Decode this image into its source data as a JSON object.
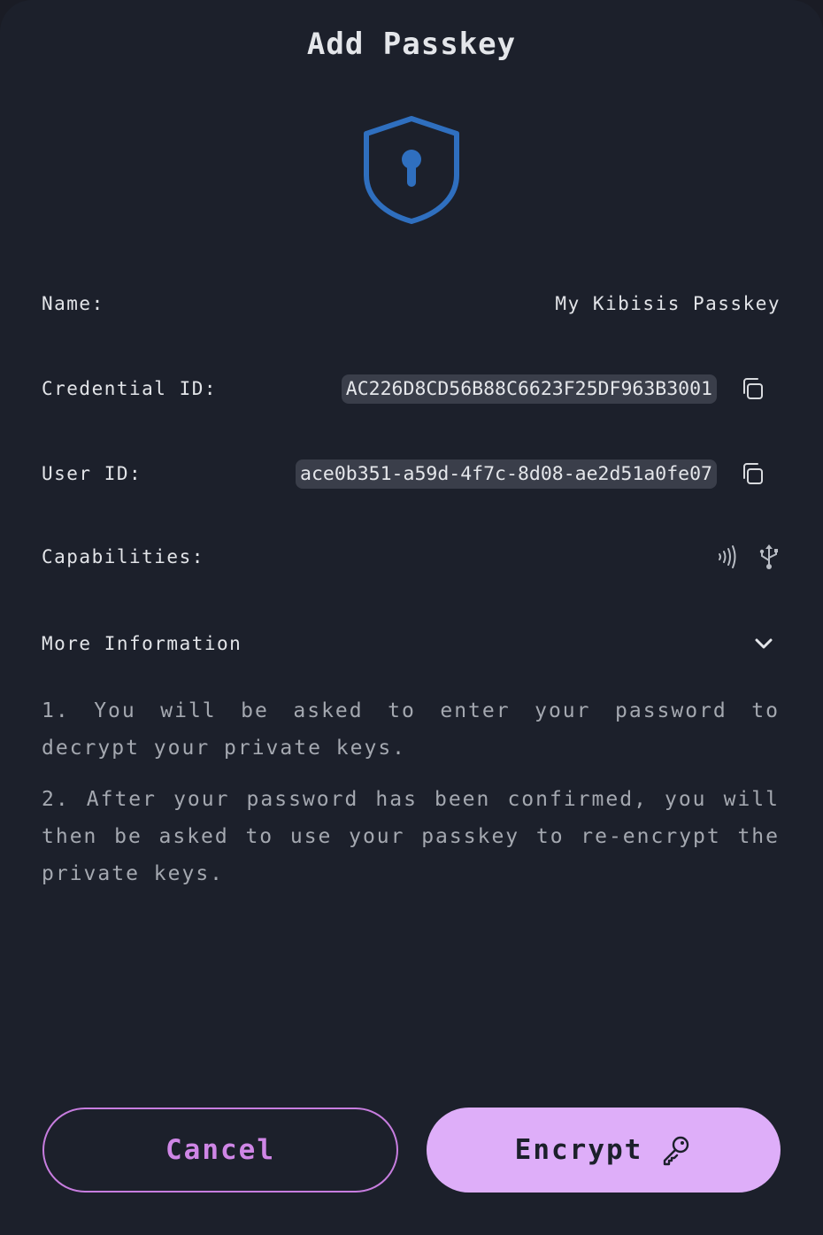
{
  "dialog": {
    "title": "Add Passkey"
  },
  "fields": {
    "name_label": "Name:",
    "name_value": "My Kibisis Passkey",
    "credential_label": "Credential ID:",
    "credential_value": "AC226D8CD56B88C6623F25DF963B3001",
    "user_label": "User ID:",
    "user_value": "ace0b351-a59d-4f7c-8d08-ae2d51a0fe07",
    "capabilities_label": "Capabilities:",
    "capabilities": [
      "nfc-icon",
      "usb-icon"
    ]
  },
  "more_info": {
    "label": "More Information",
    "step1": "1. You will be asked to enter your password to decrypt your private keys.",
    "step2": "2. After your password has been confirmed, you will then be asked to use your passkey to re-encrypt the private keys."
  },
  "actions": {
    "cancel_label": "Cancel",
    "encrypt_label": "Encrypt"
  },
  "colors": {
    "background": "#1c202b",
    "shield": "#2f6fbf",
    "accent": "#deaef9",
    "accent_outline": "#c77ddf"
  }
}
